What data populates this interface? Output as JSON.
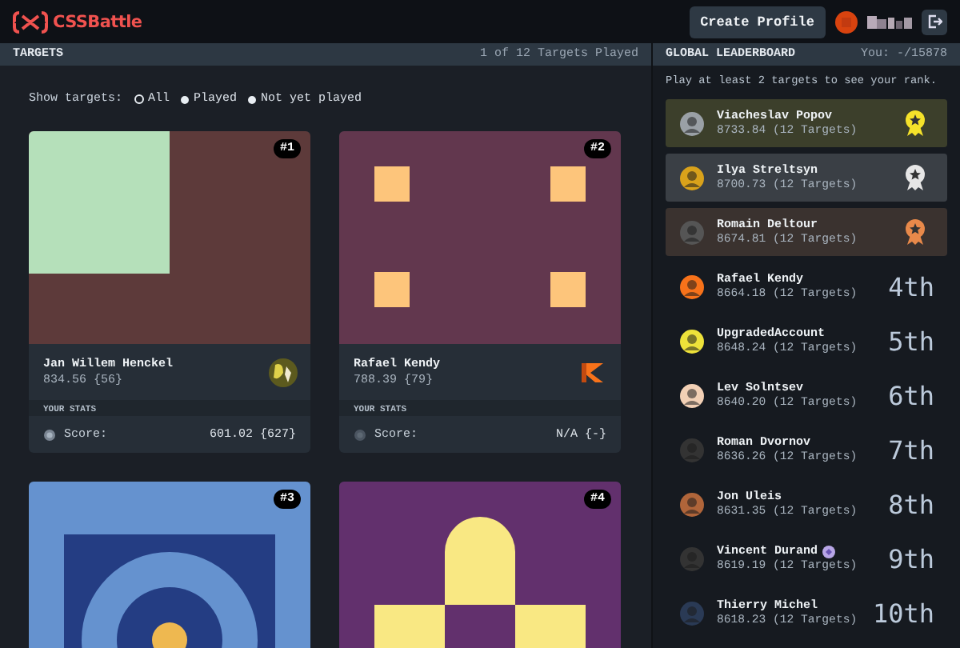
{
  "header": {
    "logo": "CSSBattle",
    "create_profile": "Create Profile"
  },
  "targets_bar": {
    "title": "TARGETS",
    "played": "1 of 12 Targets Played"
  },
  "filter": {
    "label": "Show targets:",
    "options": [
      {
        "label": "All",
        "selected": true
      },
      {
        "label": "Played",
        "selected": false
      },
      {
        "label": "Not yet played",
        "selected": false
      }
    ]
  },
  "targets": [
    {
      "number": "#1",
      "player": "Jan Willem Henckel",
      "top_score": "834.56 {56}",
      "stats_label": "YOUR STATS",
      "score_label": "Score:",
      "your_score": "601.02 {627}",
      "played": true
    },
    {
      "number": "#2",
      "player": "Rafael Kendy",
      "top_score": "788.39 {79}",
      "stats_label": "YOUR STATS",
      "score_label": "Score:",
      "your_score": "N/A {-}",
      "played": false
    },
    {
      "number": "#3"
    },
    {
      "number": "#4"
    }
  ],
  "leaderboard": {
    "title": "GLOBAL LEADERBOARD",
    "you": "You: -/15878",
    "note": "Play at least 2 targets to see your rank.",
    "rows": [
      {
        "name": "Viacheslav Popov",
        "score": "8733.84 (12 Targets)",
        "color": "#f5e22a"
      },
      {
        "name": "Ilya Streltsyn",
        "score": "8700.73 (12 Targets)",
        "color": "#e6e6e6"
      },
      {
        "name": "Romain Deltour",
        "score": "8674.81 (12 Targets)",
        "color": "#e8894a"
      },
      {
        "name": "Rafael Kendy",
        "score": "8664.18 (12 Targets)",
        "rank": "4th"
      },
      {
        "name": "UpgradedAccount",
        "score": "8648.24 (12 Targets)",
        "rank": "5th"
      },
      {
        "name": "Lev Solntsev",
        "score": "8640.20 (12 Targets)",
        "rank": "6th"
      },
      {
        "name": "Roman Dvornov",
        "score": "8636.26 (12 Targets)",
        "rank": "7th"
      },
      {
        "name": "Jon Uleis",
        "score": "8631.35 (12 Targets)",
        "rank": "8th"
      },
      {
        "name": "Vincent Durand",
        "score": "8619.19 (12 Targets)",
        "rank": "9th",
        "badge": true
      },
      {
        "name": "Thierry Michel",
        "score": "8618.23 (12 Targets)",
        "rank": "10th"
      }
    ]
  }
}
